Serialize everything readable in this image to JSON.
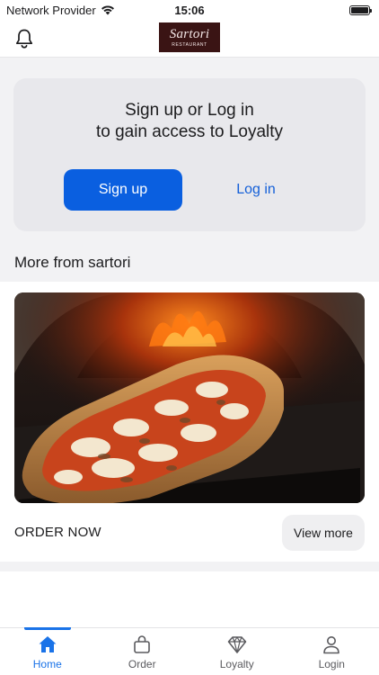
{
  "status_bar": {
    "carrier": "Network Provider",
    "time": "15:06",
    "battery_level": 1.0
  },
  "header": {
    "logo_name": "Sartori",
    "logo_sub": "RESTAURANT",
    "icons": {
      "left": "bell-icon"
    }
  },
  "login_card": {
    "line1": "Sign up or Log in",
    "line2": "to gain access to Loyalty",
    "signup_label": "Sign up",
    "login_label": "Log in"
  },
  "more_section": {
    "title": "More from sartori",
    "promo": {
      "image": "pizza-in-oven-photo",
      "cta_label": "ORDER NOW",
      "view_more_label": "View more"
    }
  },
  "tab_bar": {
    "active_index": 0,
    "tabs": [
      {
        "label": "Home",
        "icon": "home-icon"
      },
      {
        "label": "Order",
        "icon": "bag-icon"
      },
      {
        "label": "Loyalty",
        "icon": "diamond-icon"
      },
      {
        "label": "Login",
        "icon": "person-icon"
      }
    ]
  },
  "colors": {
    "primary": "#0a5fe0",
    "link": "#1560d8",
    "tab_active": "#1a73e8",
    "background": "#f2f2f4",
    "card": "#e8e8ec"
  }
}
